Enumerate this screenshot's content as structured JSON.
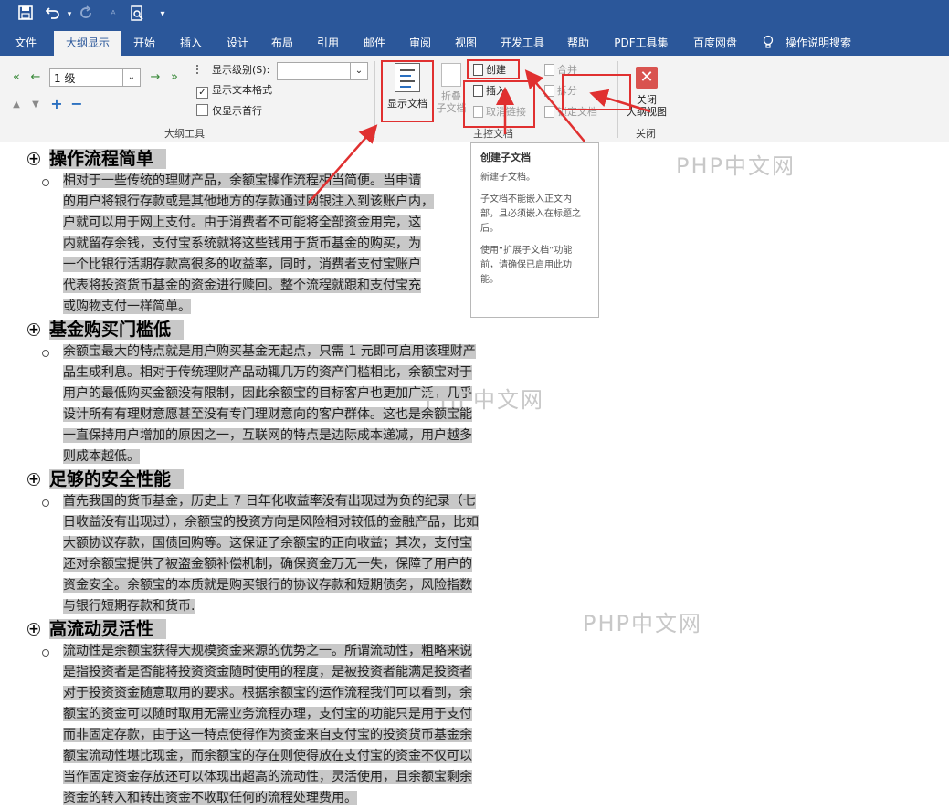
{
  "qat": {
    "icons": [
      "save-icon",
      "undo-icon",
      "redo-icon",
      "format-painter-icon",
      "print-preview-icon",
      "customize-qat-icon"
    ]
  },
  "tabs": [
    {
      "label": "文件"
    },
    {
      "label": "大纲显示"
    },
    {
      "label": "开始"
    },
    {
      "label": "插入"
    },
    {
      "label": "设计"
    },
    {
      "label": "布局"
    },
    {
      "label": "引用"
    },
    {
      "label": "邮件"
    },
    {
      "label": "审阅"
    },
    {
      "label": "视图"
    },
    {
      "label": "开发工具"
    },
    {
      "label": "帮助"
    },
    {
      "label": "PDF工具集"
    },
    {
      "label": "百度网盘"
    },
    {
      "label": "操作说明搜索"
    }
  ],
  "outline_tools": {
    "level_value": "1 级",
    "show_level_label": "显示级别(S):",
    "show_level_value": "",
    "show_text_format_label": "显示文本格式",
    "show_text_format_checked": true,
    "show_first_line_label": "仅显示首行",
    "show_first_line_checked": false,
    "group_label": "大纲工具"
  },
  "master_doc": {
    "show_document_label": "显示文档",
    "collapse_label_1": "折叠",
    "collapse_label_2": "子文档",
    "create_label": "创建",
    "insert_label": "插入",
    "unlink_label": "取消链接",
    "merge_label": "合并",
    "split_label": "拆分",
    "lock_label": "锁定文档",
    "group_label": "主控文档"
  },
  "close_group": {
    "close_label_1": "关闭",
    "close_label_2": "大纲视图",
    "group_label": "关闭"
  },
  "tooltip": {
    "title": "创建子文档",
    "line1": "新建子文档。",
    "line2": "子文档不能嵌入正文内部，且必须嵌入在标题之后。",
    "line3": "使用“扩展子文档”功能前，请确保已启用此功能。"
  },
  "watermarks": [
    "PHP中文网",
    "PHP中文网",
    "PHP中文网"
  ],
  "sections": [
    {
      "heading": "操作流程简单",
      "lines": [
        "相对于一些传统的理财产品，余额宝操作流程相当简便。当申请",
        "的用户将银行存款或是其他地方的存款通过网银注入到该账户内，",
        "户就可以用于网上支付。由于消费者不可能将全部资金用完，这",
        "内就留存余钱，支付宝系统就将这些钱用于货币基金的购买，为",
        "一个比银行活期存款高很多的收益率，同时，消费者支付宝账户",
        "代表将投资货币基金的资金进行赎回。整个流程就跟和支付宝充",
        "或购物支付一样简单。"
      ]
    },
    {
      "heading": "基金购买门槛低",
      "lines": [
        "余额宝最大的特点就是用户购买基金无起点，只需 1 元即可启用该理财产",
        "品生成利息。相对于传统理财产品动辄几万的资产门槛相比，余额宝对于",
        "用户的最低购买金额没有限制，因此余额宝的目标客户也更加广泛，几乎",
        "设计所有有理财意愿甚至没有专门理财意向的客户群体。这也是余额宝能",
        "一直保持用户增加的原因之一，互联网的特点是边际成本递减，用户越多",
        "则成本越低。"
      ]
    },
    {
      "heading": "足够的安全性能",
      "lines": [
        "首先我国的货币基金，历史上 7 日年化收益率没有出现过为负的纪录（七",
        "日收益没有出现过），余额宝的投资方向是风险相对较低的金融产品，比如",
        "大额协议存款，国债回购等。这保证了余额宝的正向收益；其次，支付宝",
        "还对余额宝提供了被盗金额补偿机制，确保资金万无一失，保障了用户的",
        "资金安全。余额宝的本质就是购买银行的协议存款和短期债务，风险指数",
        "与银行短期存款和货币."
      ]
    },
    {
      "heading": "高流动灵活性",
      "lines": [
        "流动性是余额宝获得大规模资金来源的优势之一。所谓流动性，粗略来说",
        "是指投资者是否能将投资资金随时使用的程度，是被投资者能满足投资者",
        "对于投资资金随意取用的要求。根据余额宝的运作流程我们可以看到，余",
        "额宝的资金可以随时取用无需业务流程办理，支付宝的功能只是用于支付",
        "而非固定存款，由于这一特点使得作为资金来自支付宝的投资货币基金余",
        "额宝流动性堪比现金，而余额宝的存在则使得放在支付宝的资金不仅可以",
        "当作固定资金存放还可以体现出超高的流动性，灵活使用，且余额宝剩余",
        "资金的转入和转出资金不收取任何的流程处理费用。"
      ]
    }
  ]
}
